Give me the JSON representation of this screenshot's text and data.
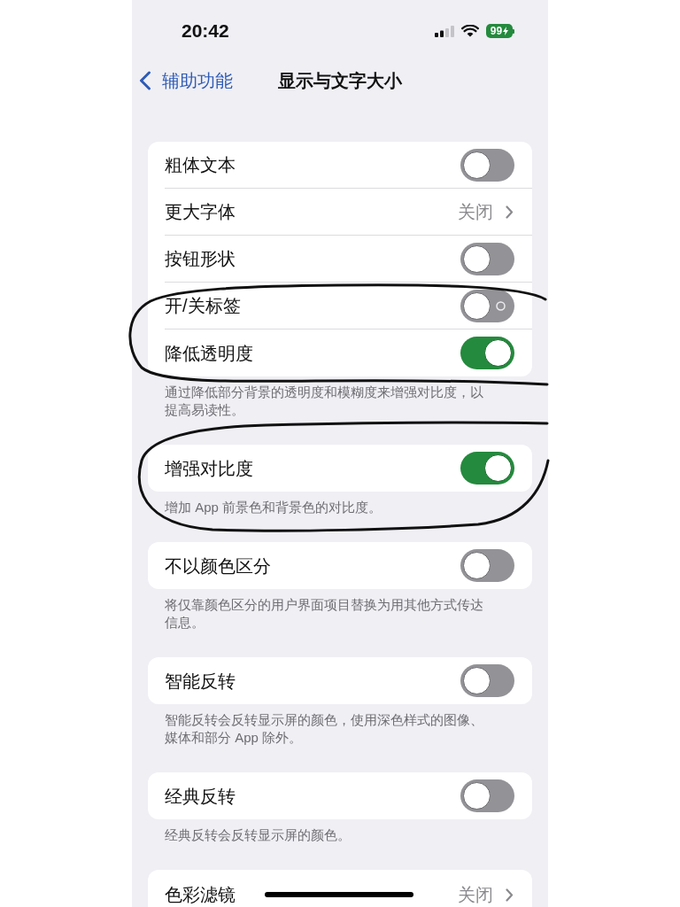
{
  "status_bar": {
    "time": "20:42",
    "battery": "99"
  },
  "nav": {
    "back": "辅助功能",
    "title": "显示与文字大小"
  },
  "groups": [
    {
      "rows": [
        {
          "kind": "toggle",
          "label": "粗体文本",
          "on": false,
          "label_icon": false
        },
        {
          "kind": "link",
          "label": "更大字体",
          "value": "关闭"
        },
        {
          "kind": "toggle",
          "label": "按钮形状",
          "on": false,
          "label_icon": false
        },
        {
          "kind": "toggle",
          "label": "开/关标签",
          "on": false,
          "label_icon": true
        },
        {
          "kind": "toggle",
          "label": "降低透明度",
          "on": true,
          "label_icon": false
        }
      ],
      "footer": "通过降低部分背景的透明度和模糊度来增强对比度，以提高易读性。"
    },
    {
      "rows": [
        {
          "kind": "toggle",
          "label": "增强对比度",
          "on": true,
          "label_icon": false
        }
      ],
      "footer": "增加 App 前景色和背景色的对比度。"
    },
    {
      "rows": [
        {
          "kind": "toggle",
          "label": "不以颜色区分",
          "on": false,
          "label_icon": false
        }
      ],
      "footer": "将仅靠颜色区分的用户界面项目替换为用其他方式传达信息。"
    },
    {
      "rows": [
        {
          "kind": "toggle",
          "label": "智能反转",
          "on": false,
          "label_icon": false
        }
      ],
      "footer": "智能反转会反转显示屏的颜色，使用深色样式的图像、媒体和部分 App 除外。"
    },
    {
      "rows": [
        {
          "kind": "toggle",
          "label": "经典反转",
          "on": false,
          "label_icon": false
        }
      ],
      "footer": "经典反转会反转显示屏的颜色。"
    },
    {
      "rows": [
        {
          "kind": "link",
          "label": "色彩滤镜",
          "value": "关闭"
        }
      ]
    }
  ]
}
